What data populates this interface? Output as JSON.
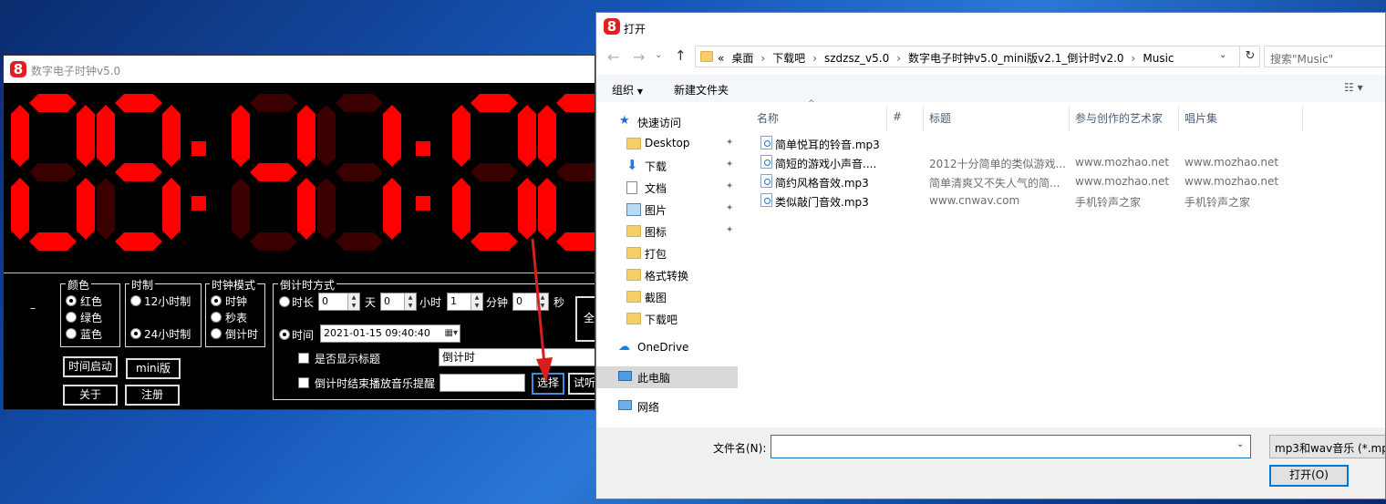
{
  "clock_window": {
    "title": "数字电子时钟v5.0",
    "logo": "8",
    "time_digits": [
      "0",
      "9",
      "4",
      "1",
      "0",
      "0"
    ],
    "dash": "–",
    "color_group": {
      "label": "颜色",
      "options": [
        "红色",
        "绿色",
        "蓝色"
      ],
      "selected": "红色"
    },
    "hour_group": {
      "label": "时制",
      "options": [
        "12小时制",
        "24小时制"
      ],
      "selected": "24小时制"
    },
    "mode_group": {
      "label": "时钟模式",
      "options": [
        "时钟",
        "秒表",
        "倒计时"
      ],
      "selected": "时钟"
    },
    "countdown_group": {
      "label": "倒计时方式",
      "duration_label": "时长",
      "day_value": "0",
      "day_unit": "天",
      "hour_value": "0",
      "hour_unit": "小时",
      "minute_value": "1",
      "minute_unit": "分钟",
      "second_value": "0",
      "second_unit": "秒",
      "time_label": "时间",
      "datetime_value": "2021-01-15 09:40:40",
      "show_title_label": "是否显示标题",
      "title_value": "倒计时",
      "music_label": "倒计时结束播放音乐提醒",
      "select_button": "选择",
      "try_button": "试听",
      "full_button": "全"
    },
    "buttons": {
      "start": "时间启动",
      "mini": "mini版",
      "about": "关于",
      "register": "注册"
    }
  },
  "dialog": {
    "logo": "8",
    "title": "打开",
    "breadcrumb": [
      "«",
      "桌面",
      "下载吧",
      "szdzsz_v5.0",
      "数字电子时钟v5.0_mini版v2.1_倒计时v2.0",
      "Music"
    ],
    "search_placeholder": "搜索\"Music\"",
    "toolbar": {
      "organize": "组织",
      "new_folder": "新建文件夹"
    },
    "nav": {
      "quick_access": "快速访问",
      "items": [
        "Desktop",
        "下载",
        "文档",
        "图片",
        "图标",
        "打包",
        "格式转换",
        "截图",
        "下载吧"
      ],
      "onedrive": "OneDrive",
      "this_pc": "此电脑",
      "network": "网络"
    },
    "columns": [
      "名称",
      "#",
      "标题",
      "参与创作的艺术家",
      "唱片集"
    ],
    "files": [
      {
        "name": "简单悦耳的铃音.mp3",
        "num": "",
        "title": "",
        "artist": "",
        "album": ""
      },
      {
        "name": "简短的游戏小声音....",
        "num": "",
        "title": "2012十分简单的类似游戏...",
        "artist": "www.mozhao.net",
        "album": "www.mozhao.net"
      },
      {
        "name": "简约风格音效.mp3",
        "num": "",
        "title": "简单清爽又不失人气的简...",
        "artist": "www.mozhao.net",
        "album": "www.mozhao.net"
      },
      {
        "name": "类似敲门音效.mp3",
        "num": "",
        "title": "www.cnwav.com",
        "artist": "手机铃声之家",
        "album": "手机铃声之家"
      }
    ],
    "filename_label": "文件名(N):",
    "filename_value": "",
    "filetype": "mp3和wav音乐 (*.mp3",
    "open_button": "打开(O)"
  },
  "colors": {
    "digit_on": "#ff0000",
    "digit_off": "#3a0000",
    "accent": "#cce8ff",
    "select_highlight": "#0078d7"
  }
}
